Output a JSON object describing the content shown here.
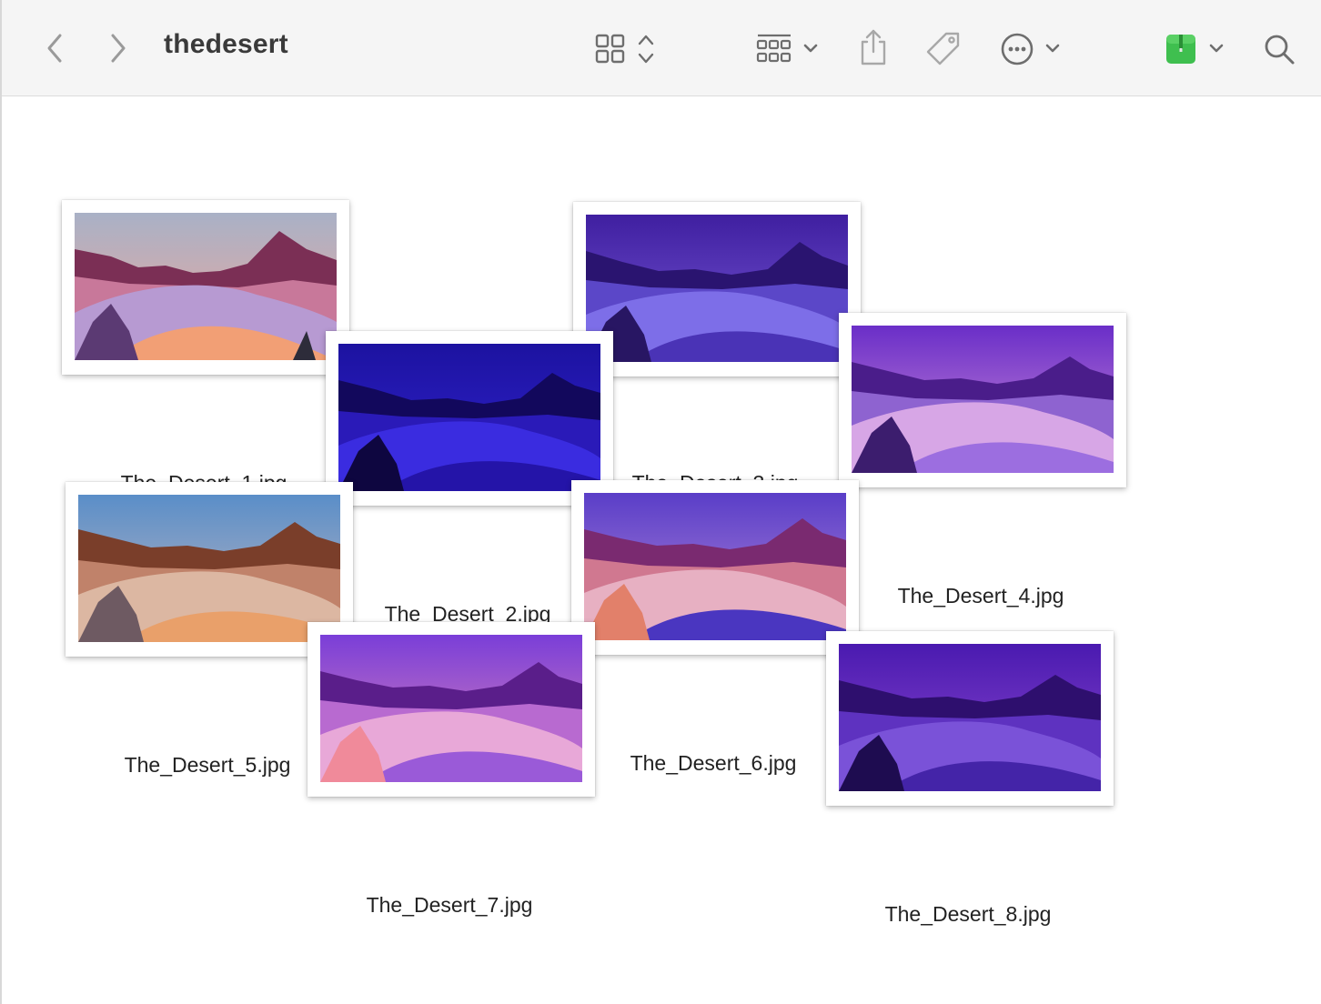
{
  "window": {
    "title": "thedesert"
  },
  "toolbar": {
    "back_icon": "chevron-left-icon",
    "forward_icon": "chevron-right-icon",
    "view_icon": "icon-grid-view-icon",
    "group_icon": "group-by-icon",
    "share_icon": "share-icon",
    "tag_icon": "tag-icon",
    "more_icon": "ellipsis-circle-icon",
    "app_icon": "archive-app-icon",
    "search_icon": "search-icon"
  },
  "files": [
    {
      "name": "The_Desert_1.jpg"
    },
    {
      "name": "The_Desert_2.jpg"
    },
    {
      "name": "The_Desert_3.jpg"
    },
    {
      "name": "The_Desert_4.jpg"
    },
    {
      "name": "The_Desert_5.jpg"
    },
    {
      "name": "The_Desert_6.jpg"
    },
    {
      "name": "The_Desert_7.jpg"
    },
    {
      "name": "The_Desert_8.jpg"
    }
  ],
  "colors": {
    "toolbar_bg": "#f5f5f5",
    "icon_gray": "#7a7a7a",
    "app_icon_green": "#3fbf4f"
  }
}
